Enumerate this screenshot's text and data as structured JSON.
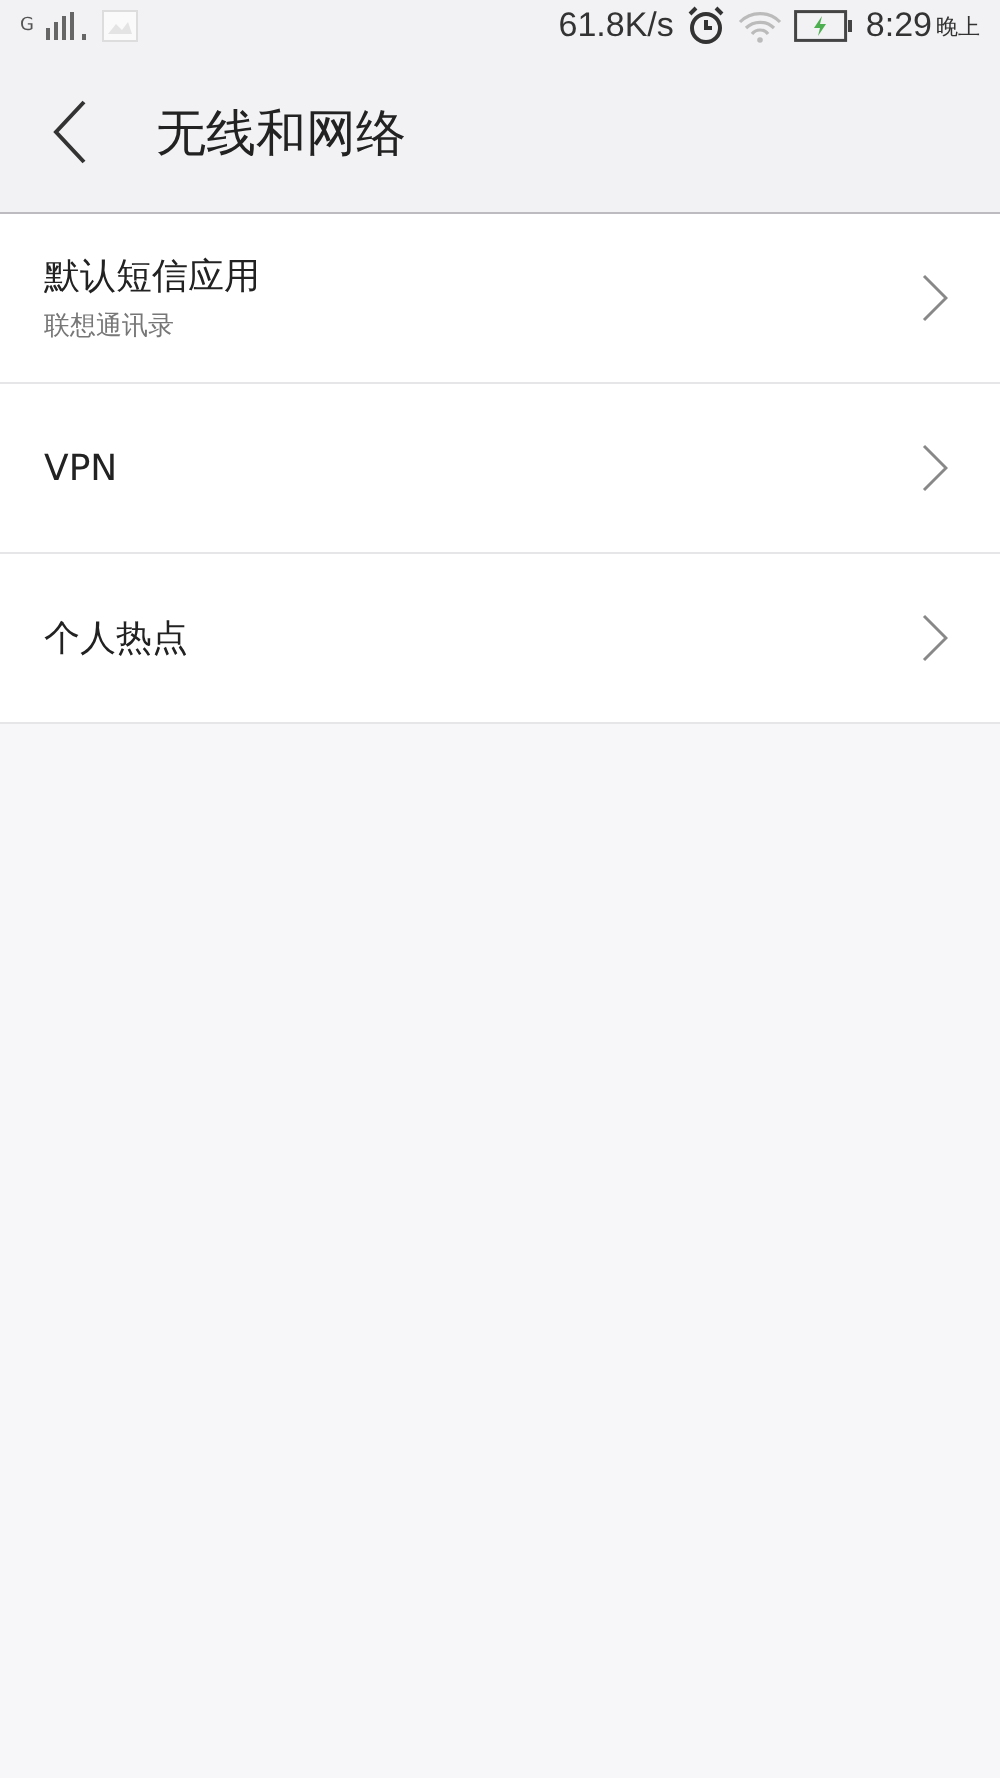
{
  "status_bar": {
    "network": "G",
    "speed": "61.8K/s",
    "time": "8:29",
    "period": "晚上"
  },
  "header": {
    "title": "无线和网络"
  },
  "items": [
    {
      "title": "默认短信应用",
      "subtitle": "联想通讯录"
    },
    {
      "title": "VPN"
    },
    {
      "title": "个人热点"
    }
  ]
}
